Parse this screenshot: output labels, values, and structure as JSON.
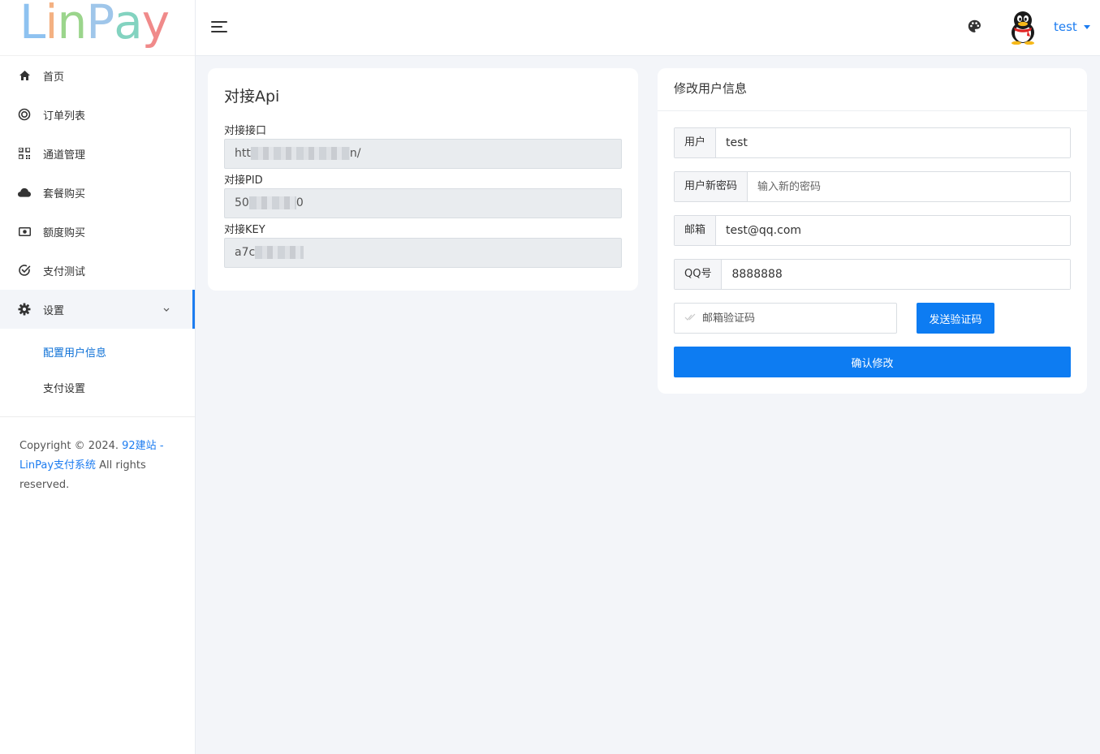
{
  "logo": {
    "text": "LinPay",
    "letters": [
      "L",
      "i",
      "n",
      "P",
      "a",
      "y"
    ],
    "colors": [
      "#8ec2f0",
      "#f4b182",
      "#9bd58c",
      "#9fc6ea",
      "#83d3c0",
      "#f08a8a"
    ]
  },
  "sidebar": {
    "items": [
      {
        "label": "首页",
        "icon": "home-icon"
      },
      {
        "label": "订单列表",
        "icon": "target-icon"
      },
      {
        "label": "通道管理",
        "icon": "qrcode-icon"
      },
      {
        "label": "套餐购买",
        "icon": "cloud-icon"
      },
      {
        "label": "额度购买",
        "icon": "money-icon"
      },
      {
        "label": "支付测试",
        "icon": "check-circle-icon"
      },
      {
        "label": "设置",
        "icon": "gear-icon"
      }
    ],
    "sub_items": [
      {
        "label": "配置用户信息",
        "active": true
      },
      {
        "label": "支付设置",
        "active": false
      }
    ]
  },
  "footer": {
    "prefix": "Copyright © 2024. ",
    "link1": "92建站 - ",
    "link2": "LinPay支付系统",
    "suffix": " All rights reserved."
  },
  "header": {
    "username": "test"
  },
  "api_card": {
    "title": "对接Api",
    "fields": [
      {
        "label": "对接接口",
        "prefix": "htt",
        "suffix": "n/"
      },
      {
        "label": "对接PID",
        "prefix": "50",
        "suffix": "0"
      },
      {
        "label": "对接KEY",
        "prefix": "a7c",
        "suffix": ""
      }
    ]
  },
  "user_card": {
    "title": "修改用户信息",
    "user_label": "用户",
    "user_value": "test",
    "password_label": "用户新密码",
    "password_placeholder": "输入新的密码",
    "email_label": "邮箱",
    "email_value": "test@qq.com",
    "qq_label": "QQ号",
    "qq_value": "8888888",
    "code_placeholder": "邮箱验证码",
    "send_code_label": "发送验证码",
    "confirm_label": "确认修改"
  },
  "colors": {
    "accent": "#0d7cf2",
    "link": "#1c7cf0",
    "background": "#f3f5f9"
  }
}
